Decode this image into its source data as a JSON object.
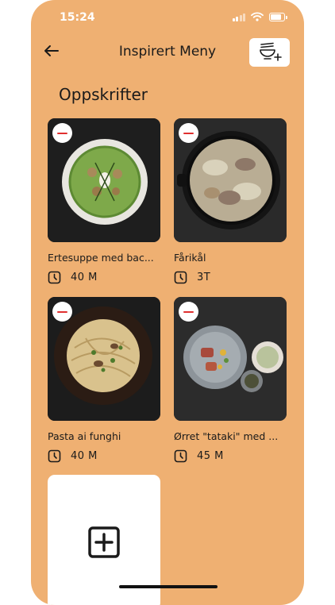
{
  "status_bar": {
    "time": "15:24"
  },
  "header": {
    "title": "Inspirert Meny"
  },
  "section": {
    "title": "Oppskrifter"
  },
  "recipes": [
    {
      "name": "Ertesuppe med bac...",
      "time": "40 M"
    },
    {
      "name": "Fårikål",
      "time": "3T"
    },
    {
      "name": "Pasta ai funghi",
      "time": "40 M"
    },
    {
      "name": "Ørret \"tataki\" med ...",
      "time": "45 M"
    }
  ],
  "icons": {
    "back": "back-arrow-icon",
    "add_menu": "bowl-plus-icon",
    "remove": "minus-icon",
    "time": "clock-icon",
    "add_recipe": "plus-square-icon"
  },
  "colors": {
    "background": "#efb072",
    "card": "#ffffff",
    "remove_accent": "#e03030"
  }
}
